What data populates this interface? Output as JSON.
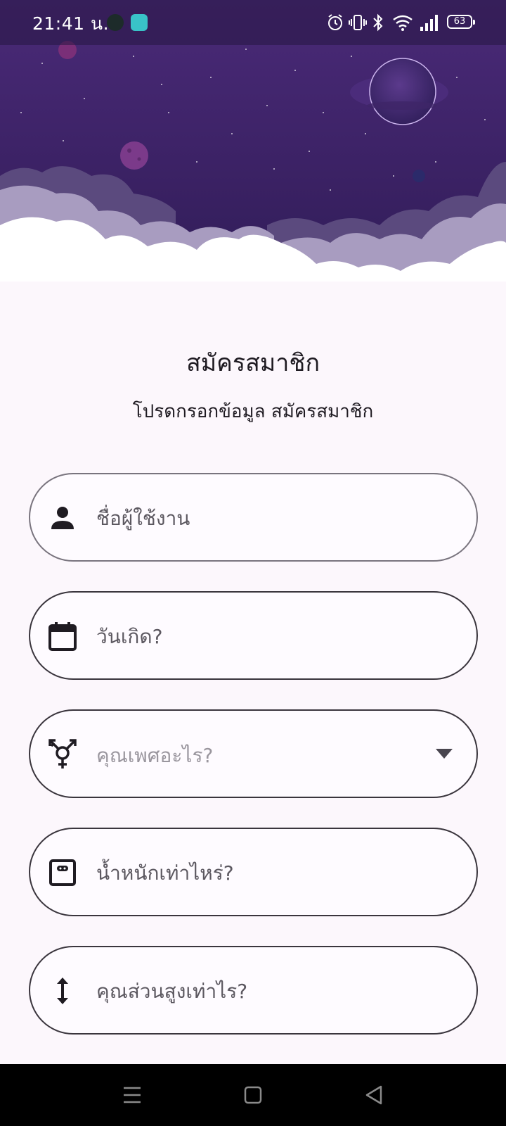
{
  "status_bar": {
    "time": "21:41 น.",
    "battery_level": "63"
  },
  "title": "สมัครสมาชิก",
  "subtitle": "โปรดกรอกข้อมูล สมัครสมาชิก",
  "form": {
    "username_placeholder": "ชื่อผู้ใช้งาน",
    "birthday_placeholder": "วันเกิด?",
    "gender_placeholder": "คุณเพศอะไร?",
    "weight_placeholder": "น้ำหนักเท่าไหร่?",
    "height_placeholder": "คุณส่วนสูงเท่าไร?"
  },
  "icons": {
    "username": "person-icon",
    "birthday": "calendar-icon",
    "gender": "transgender-icon",
    "weight": "scale-icon",
    "height": "height-arrows-icon",
    "dropdown": "caret-down-icon"
  },
  "colors": {
    "sky_top": "#3b1f63",
    "sky_bottom": "#2a1a52",
    "background": "#fcf7fc",
    "field_border": "#79747e"
  }
}
